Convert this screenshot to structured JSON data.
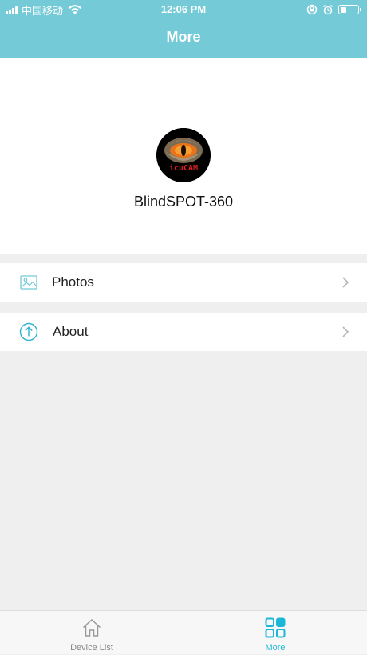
{
  "status_bar": {
    "carrier": "中国移动",
    "time": "12:06 PM",
    "battery_level": 0.35
  },
  "header": {
    "title": "More"
  },
  "profile": {
    "device_name": "BlindSPOT-360",
    "avatar_text": "icuCAM"
  },
  "menu": [
    {
      "label": "Photos",
      "icon": "image-icon"
    },
    {
      "label": "About",
      "icon": "upload-arrow-icon"
    }
  ],
  "tabbar": {
    "tabs": [
      {
        "label": "Device List",
        "icon": "home-icon",
        "active": false
      },
      {
        "label": "More",
        "icon": "grid-icon",
        "active": true
      }
    ]
  },
  "colors": {
    "header_bg": "#74cad6",
    "accent": "#1cb7d6",
    "background": "#efefef"
  }
}
